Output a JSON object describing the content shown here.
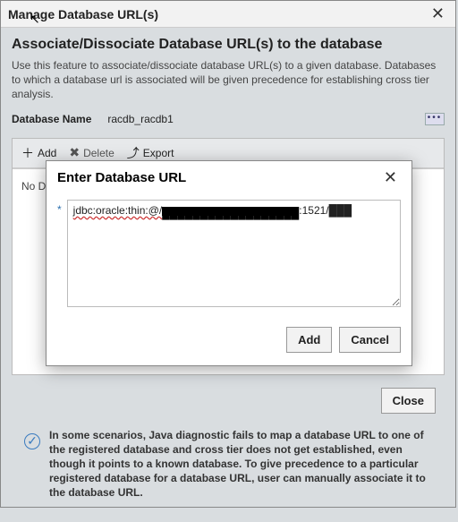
{
  "outer": {
    "title": "Manage Database URL(s)"
  },
  "heading": "Associate/Dissociate Database URL(s) to the database",
  "description": "Use this feature to associate/dissociate database URL(s) to a given database. Databases to which a database url is associated will be given precedence for establishing cross tier analysis.",
  "db": {
    "label": "Database Name",
    "value": "racdb_racdb1"
  },
  "toolbar": {
    "add": "Add",
    "delete": "Delete",
    "export": "Export"
  },
  "grid": {
    "empty": "No Data"
  },
  "close_label": "Close",
  "info_text": "In some scenarios, Java diagnostic fails to map a database URL to one of the registered database and cross tier does not get established, even though it points to a known database. To give precedence to a particular registered database for a database URL, user can manually associate it to the database URL.",
  "modal": {
    "title": "Enter Database URL",
    "required_marker": "*",
    "url_prefix": "jdbc:oracle:thin:@/",
    "url_obscured": "██████████████████",
    "url_suffix": ":1521/███",
    "add_label": "Add",
    "cancel_label": "Cancel"
  }
}
